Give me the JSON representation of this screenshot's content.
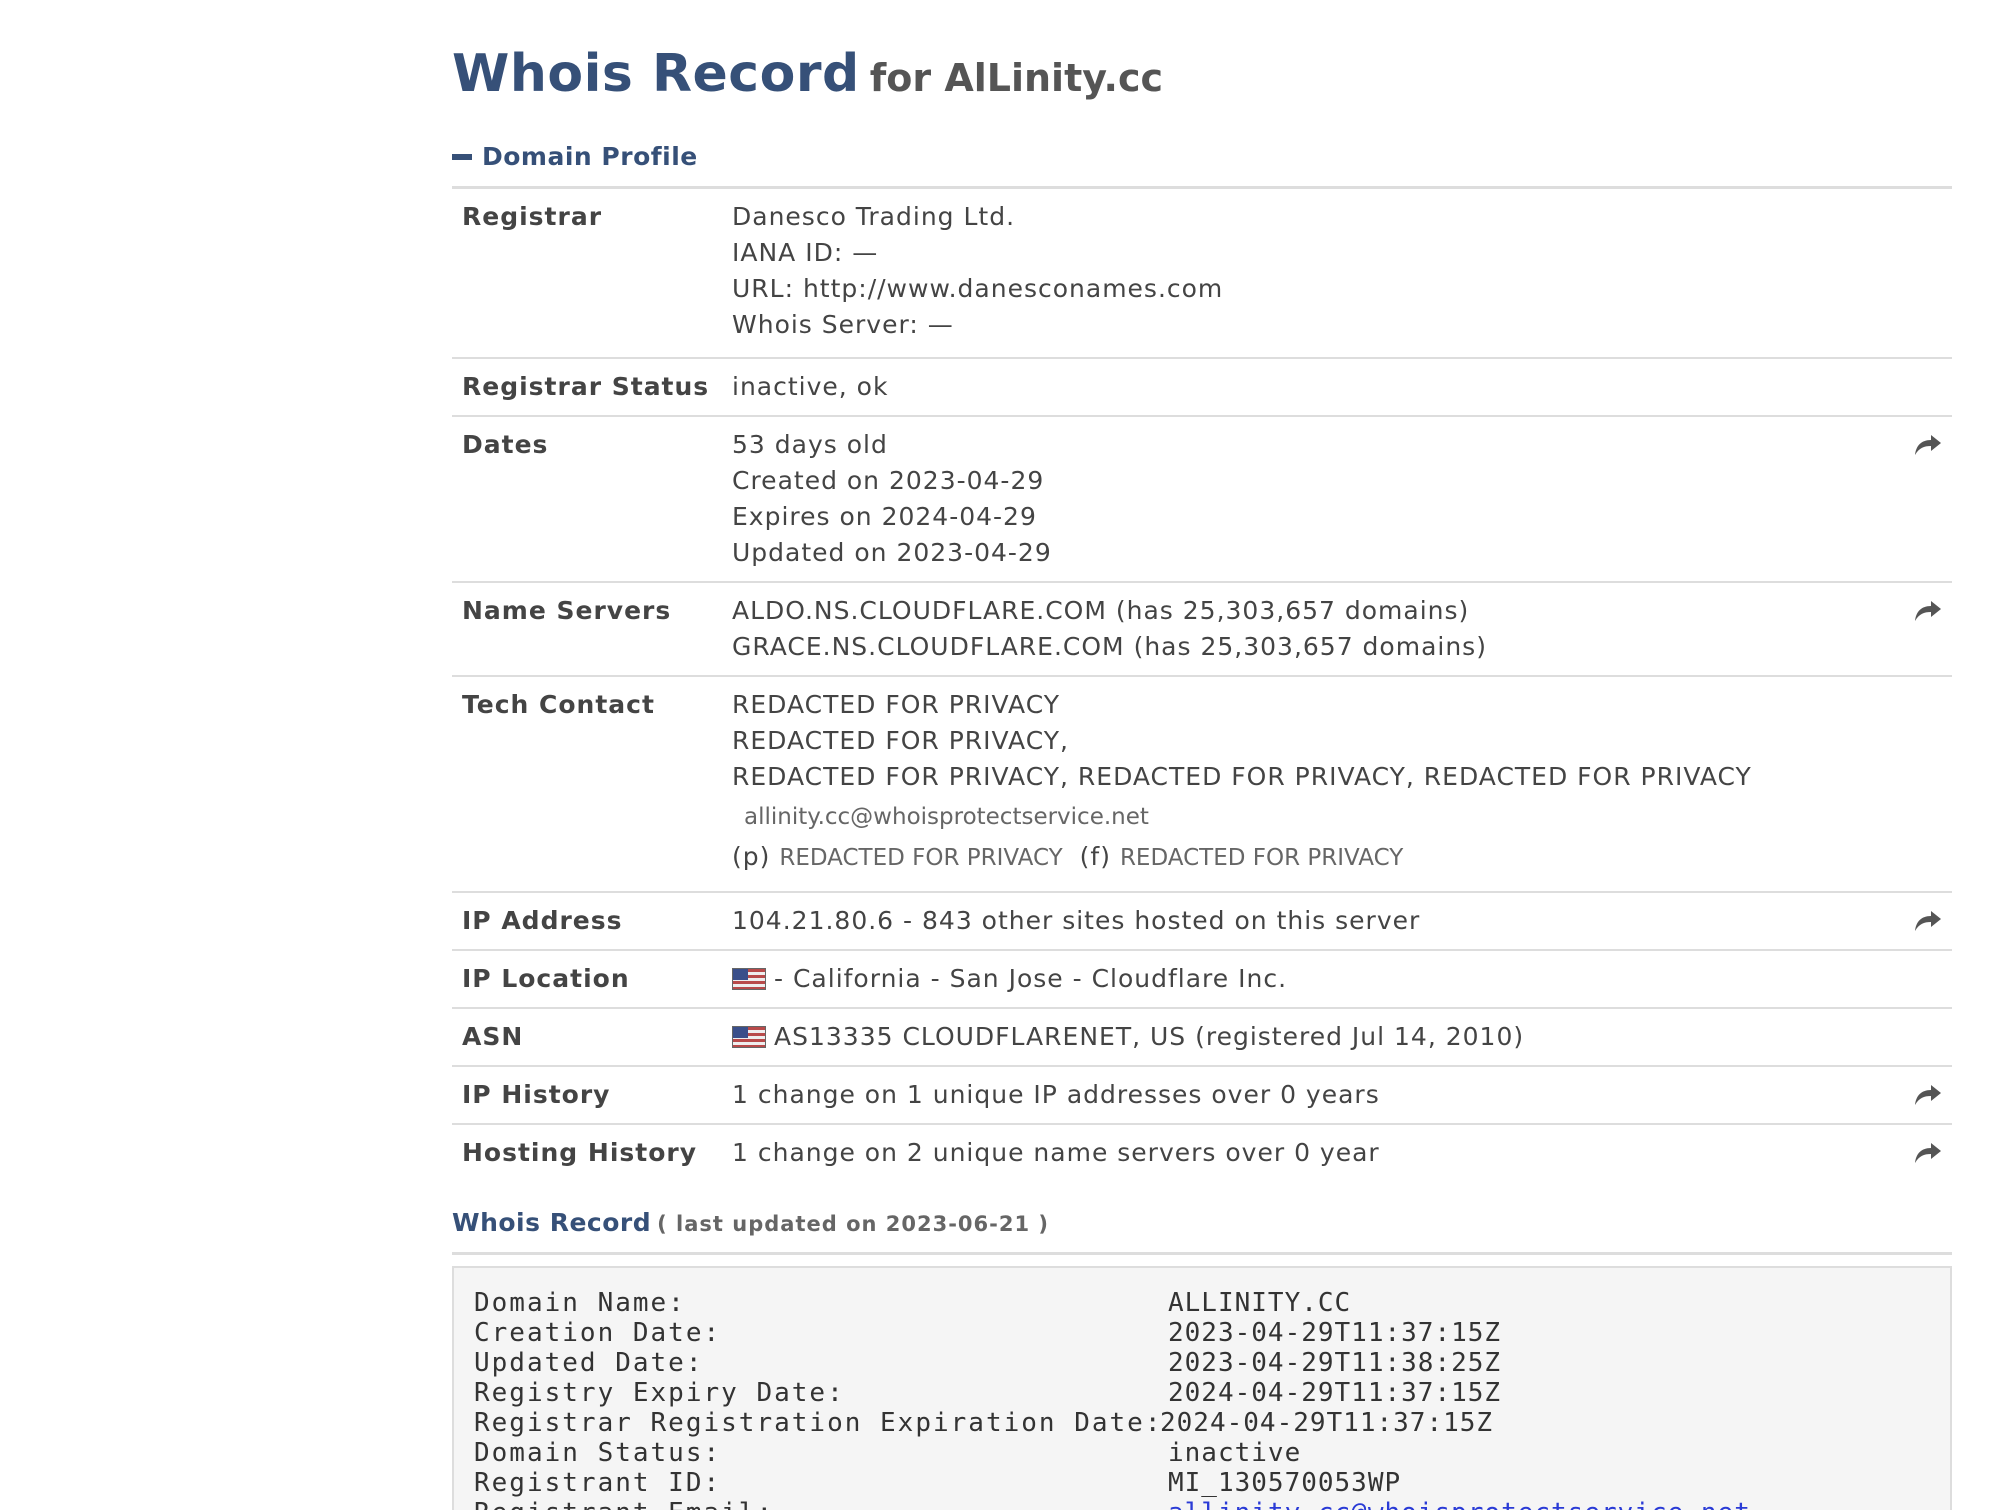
{
  "header": {
    "title": "Whois Record",
    "subtitle": "for AlLinity.cc"
  },
  "section": {
    "title": "Domain Profile"
  },
  "profile": {
    "registrar": {
      "label": "Registrar",
      "lines": [
        "Danesco Trading Ltd.",
        "IANA ID: —",
        "URL: http://www.danesconame​s.com",
        "Whois Server: —"
      ]
    },
    "registrar_status": {
      "label": "Registrar Status",
      "value": "inactive, ok"
    },
    "dates": {
      "label": "Dates",
      "lines": [
        "53 days old",
        "Created on 2023-04-29",
        "Expires on 2024-04-29",
        "Updated on 2023-04-29"
      ]
    },
    "name_servers": {
      "label": "Name Servers",
      "lines": [
        "ALDO.NS.CLOUDFLARE.COM (has 25,303,657 domains)",
        "GRACE.NS.CLOUDFLARE.COM (has 25,303,657 domains)"
      ]
    },
    "tech_contact": {
      "label": "Tech Contact",
      "lines": [
        "REDACTED FOR PRIVACY",
        "REDACTED FOR PRIVACY,",
        "REDACTED FOR PRIVACY, REDACTED FOR PRIVACY, REDACTED FOR PRIVACY"
      ],
      "email": "allinity.cc@whoisprotectservice.net",
      "phone_prefix": "(p)",
      "phone": "REDACTED FOR PRIVACY",
      "fax_prefix": "(f)",
      "fax": "REDACTED FOR PRIVACY"
    },
    "ip_address": {
      "label": "IP Address",
      "value": "104.21.80.6 - 843 other sites hosted on this server"
    },
    "ip_location": {
      "label": "IP Location",
      "value": "- California - San Jose - Cloudflare Inc."
    },
    "asn": {
      "label": "ASN",
      "value": "AS13335 CLOUDFLARENET, US (registered Jul 14, 2010)"
    },
    "ip_history": {
      "label": "IP History",
      "value": "1 change on 1 unique IP addresses over 0 years"
    },
    "hosting_history": {
      "label": "Hosting History",
      "value": "1 change on 2 unique name servers over 0 year"
    }
  },
  "whois_record": {
    "title": "Whois Record",
    "updated": "( last updated on 2023-06-21 )",
    "lines": [
      {
        "key": "Domain Name:",
        "value": "ALLINITY.CC"
      },
      {
        "key": "Creation Date:",
        "value": "2023-04-29T11:37:15Z"
      },
      {
        "key": "Updated Date:",
        "value": "2023-04-29T11:38:25Z"
      },
      {
        "key": "Registry Expiry Date:",
        "value": "2024-04-29T11:37:15Z"
      },
      {
        "key": "Registrar Registration Expiration Date:",
        "value": "2024-04-29T11:37:15Z"
      },
      {
        "key": "Domain Status:",
        "value": "inactive"
      },
      {
        "key": "Registrant ID:",
        "value": "MI_130570053WP"
      },
      {
        "key": "Registrant Email:",
        "value": "allinity.cc@whoisprotectservice.net"
      }
    ]
  },
  "icons": {
    "share": "share-arrow-icon",
    "collapse": "minus-icon",
    "flag": "us-flag-icon"
  },
  "colors": {
    "heading": "#365078",
    "link": "#2a3bd6",
    "rule": "#dddddd"
  }
}
